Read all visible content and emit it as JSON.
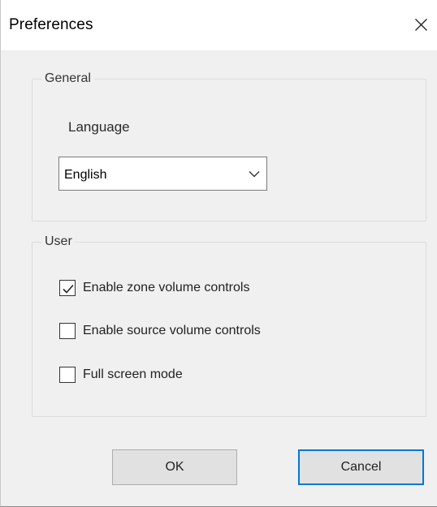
{
  "window": {
    "title": "Preferences",
    "close_icon": "close-icon"
  },
  "general": {
    "legend": "General",
    "language_label": "Language",
    "language_select": {
      "value": "English",
      "icon": "chevron-down-icon"
    }
  },
  "user": {
    "legend": "User",
    "options": [
      {
        "label": "Enable zone volume controls",
        "checked": true
      },
      {
        "label": "Enable source volume controls",
        "checked": false
      },
      {
        "label": "Full screen mode",
        "checked": false
      }
    ]
  },
  "buttons": {
    "ok": "OK",
    "cancel": "Cancel"
  },
  "colors": {
    "dialog_bg": "#f0f0f0",
    "titlebar_bg": "#ffffff",
    "default_button_border": "#0078d7"
  }
}
